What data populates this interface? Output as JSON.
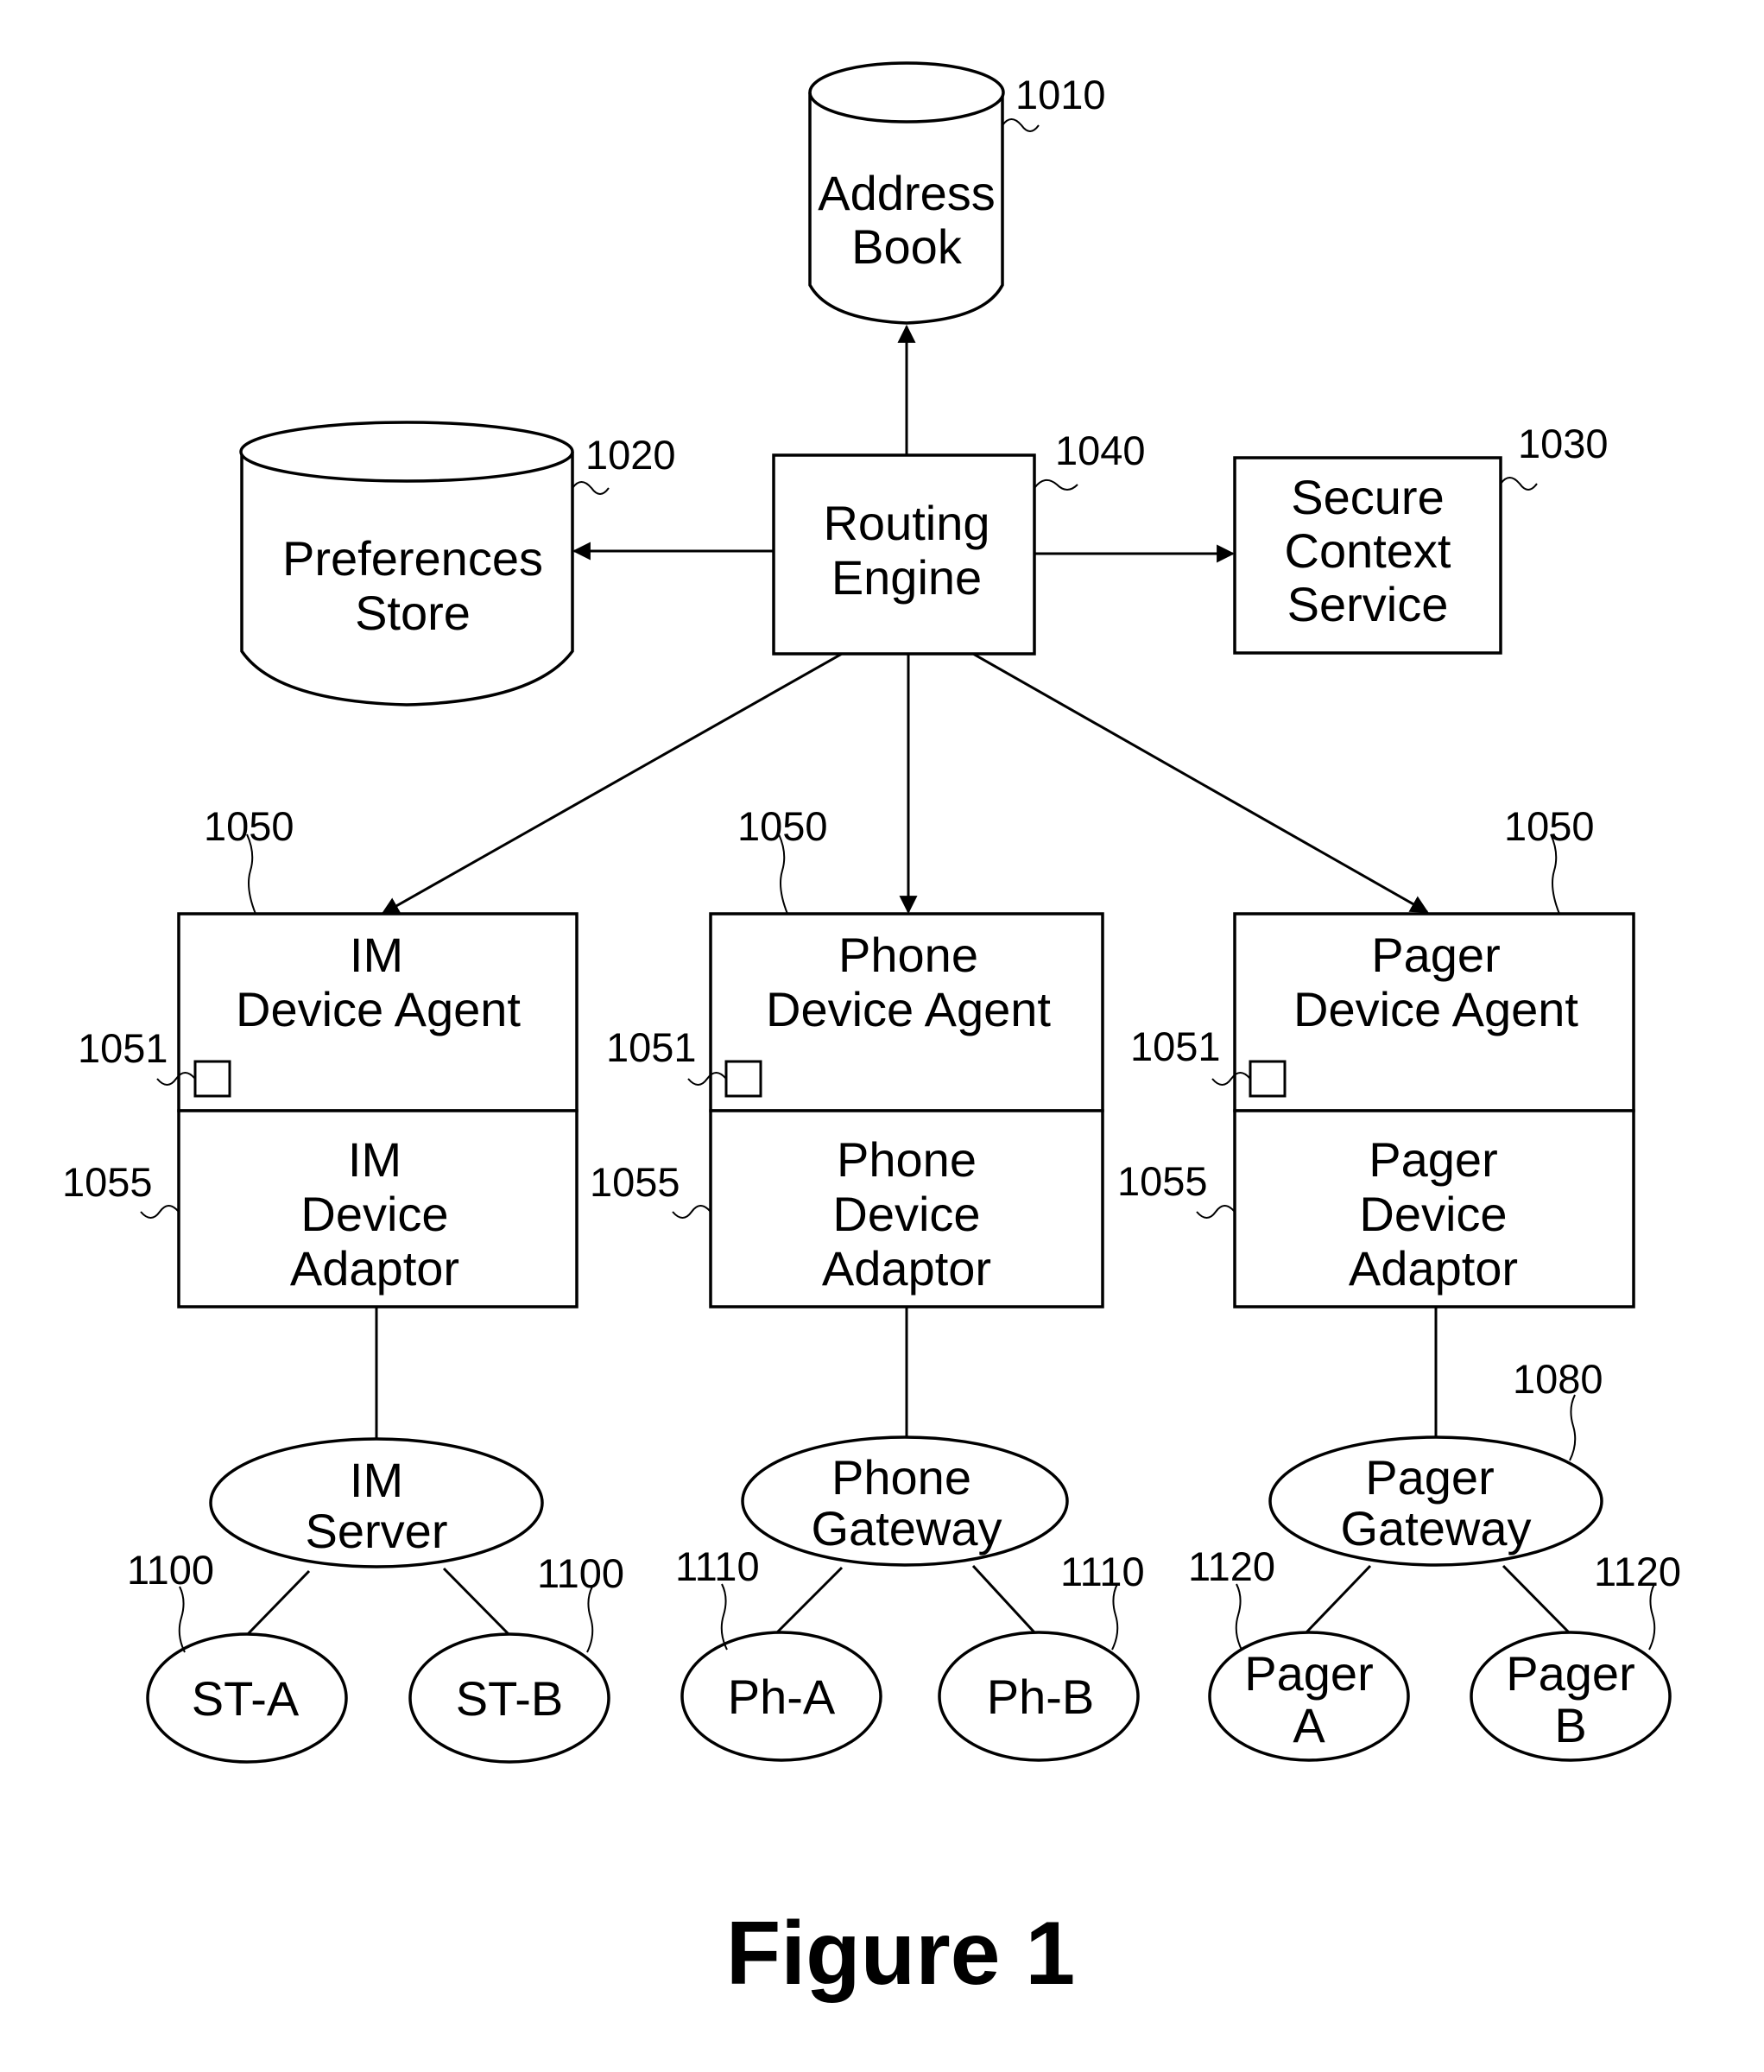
{
  "figure": {
    "caption": "Figure 1"
  },
  "nodes": {
    "address_book": {
      "lines": [
        "Address",
        "Book"
      ],
      "ref": "1010",
      "shape": "cylinder"
    },
    "preferences_store": {
      "lines": [
        "Preferences",
        "Store"
      ],
      "ref": "1020",
      "shape": "cylinder"
    },
    "routing_engine": {
      "lines": [
        "Routing",
        "Engine"
      ],
      "ref": "1040",
      "shape": "box"
    },
    "secure_context_service": {
      "lines": [
        "Secure",
        "Context",
        "Service"
      ],
      "ref": "1030",
      "shape": "box"
    },
    "im_agent": {
      "lines": [
        "IM",
        "Device Agent"
      ],
      "ref": "1050",
      "sub_ref": "1051"
    },
    "im_adaptor": {
      "lines": [
        "IM",
        "Device",
        "Adaptor"
      ],
      "ref": "1055"
    },
    "phone_agent": {
      "lines": [
        "Phone",
        "Device Agent"
      ],
      "ref": "1050",
      "sub_ref": "1051"
    },
    "phone_adaptor": {
      "lines": [
        "Phone",
        "Device",
        "Adaptor"
      ],
      "ref": "1055"
    },
    "pager_agent": {
      "lines": [
        "Pager",
        "Device Agent"
      ],
      "ref": "1050",
      "sub_ref": "1051"
    },
    "pager_adaptor": {
      "lines": [
        "Pager",
        "Device",
        "Adaptor"
      ],
      "ref": "1055"
    },
    "im_server": {
      "lines": [
        "IM",
        "Server"
      ]
    },
    "phone_gateway": {
      "lines": [
        "Phone",
        "Gateway"
      ]
    },
    "pager_gateway": {
      "lines": [
        "Pager",
        "Gateway"
      ],
      "ref": "1080"
    },
    "st_a": {
      "lines": [
        "ST-A"
      ],
      "ref": "1100"
    },
    "st_b": {
      "lines": [
        "ST-B"
      ],
      "ref": "1100"
    },
    "ph_a": {
      "lines": [
        "Ph-A"
      ],
      "ref": "1110"
    },
    "ph_b": {
      "lines": [
        "Ph-B"
      ],
      "ref": "1110"
    },
    "pager_a": {
      "lines": [
        "Pager",
        "A"
      ],
      "ref": "1120"
    },
    "pager_b": {
      "lines": [
        "Pager",
        "B"
      ],
      "ref": "1120"
    }
  },
  "edges": [
    {
      "from": "Routing Engine",
      "to": "Address Book",
      "arrow": true
    },
    {
      "from": "Routing Engine",
      "to": "Preferences Store",
      "arrow": true
    },
    {
      "from": "Routing Engine",
      "to": "Secure Context Service",
      "arrow": true
    },
    {
      "from": "Routing Engine",
      "to": "IM Device Agent",
      "arrow": true
    },
    {
      "from": "Routing Engine",
      "to": "Phone Device Agent",
      "arrow": true
    },
    {
      "from": "Routing Engine",
      "to": "Pager Device Agent",
      "arrow": true
    },
    {
      "from": "IM Device Adaptor",
      "to": "IM Server",
      "arrow": false
    },
    {
      "from": "Phone Device Adaptor",
      "to": "Phone Gateway",
      "arrow": false
    },
    {
      "from": "Pager Device Adaptor",
      "to": "Pager Gateway",
      "arrow": false
    },
    {
      "from": "IM Server",
      "to": "ST-A",
      "arrow": false
    },
    {
      "from": "IM Server",
      "to": "ST-B",
      "arrow": false
    },
    {
      "from": "Phone Gateway",
      "to": "Ph-A",
      "arrow": false
    },
    {
      "from": "Phone Gateway",
      "to": "Ph-B",
      "arrow": false
    },
    {
      "from": "Pager Gateway",
      "to": "Pager A",
      "arrow": false
    },
    {
      "from": "Pager Gateway",
      "to": "Pager B",
      "arrow": false
    }
  ]
}
